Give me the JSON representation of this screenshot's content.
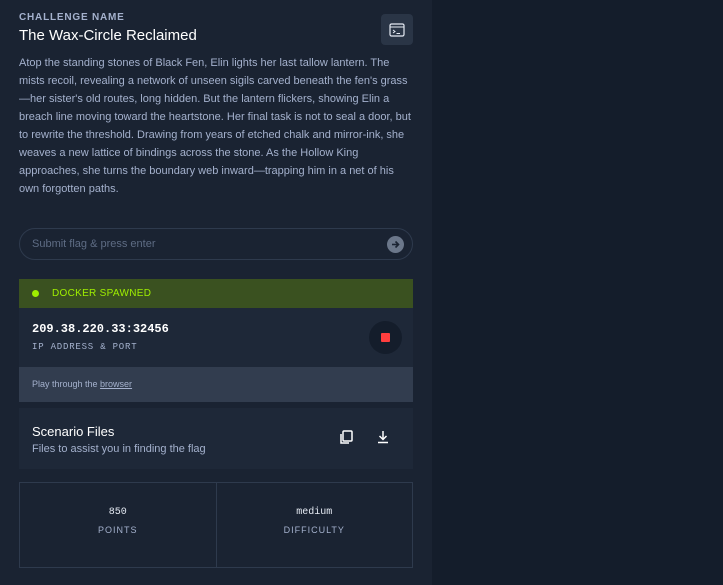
{
  "challenge": {
    "eyebrow": "CHALLENGE NAME",
    "title": "The Wax-Circle Reclaimed",
    "description": "Atop the standing stones of Black Fen, Elin lights her last tallow lantern. The mists recoil, revealing a network of unseen sigils carved beneath the fen's grass—her sister's old routes, long hidden. But the lantern flickers, showing Elin a breach line moving toward the heartstone. Her final task is not to seal a door, but to rewrite the threshold. Drawing from years of etched chalk and mirror-ink, she weaves a new lattice of bindings across the stone. As the Hollow King approaches, she turns the boundary web inward—trapping him in a net of his own forgotten paths."
  },
  "flag": {
    "placeholder": "Submit flag & press enter",
    "value": ""
  },
  "docker": {
    "status": "DOCKER SPAWNED",
    "ip_port": "209.38.220.33:32456",
    "ip_label": "IP ADDRESS & PORT",
    "browser_prefix": "Play through the ",
    "browser_link": "browser"
  },
  "files": {
    "title": "Scenario Files",
    "subtitle": "Files to assist you in finding the flag"
  },
  "stats": {
    "points_value": "850",
    "points_label": "POINTS",
    "difficulty_value": "medium",
    "difficulty_label": "DIFFICULTY"
  },
  "icons": {
    "terminal": "terminal-icon",
    "submit": "arrow-right-circle-icon",
    "stop": "stop-icon",
    "copy": "copy-icon",
    "download": "download-icon",
    "status_dot": "status-dot-icon"
  },
  "colors": {
    "panel_bg": "#1a2332",
    "page_bg": "#141d2b",
    "accent_green": "#9fef00",
    "docker_bar": "#3a5120",
    "stop_red": "#ff3e3e"
  }
}
